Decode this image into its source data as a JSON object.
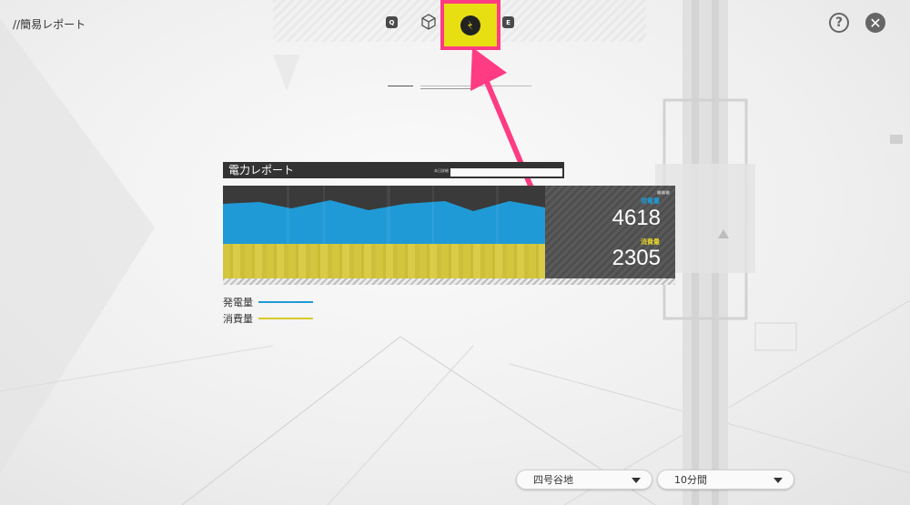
{
  "header": {
    "title": "//簡易レポート",
    "tabs": [
      {
        "label": "Q",
        "icon": "q-key-icon"
      },
      {
        "label": "",
        "icon": "cube-icon"
      },
      {
        "label": "",
        "icon": "power-icon",
        "active": true
      },
      {
        "label": "E",
        "icon": "e-key-icon"
      }
    ],
    "help_label": "?",
    "close_label": "✕"
  },
  "panel": {
    "title": "電力レポート",
    "header_tag": "本日詳細",
    "generation_label": "発電量",
    "generation_value": "4618",
    "consumption_label": "消費量",
    "consumption_value": "2305"
  },
  "legend": {
    "generation": "発電量",
    "consumption": "消費量"
  },
  "selects": {
    "area": "四号谷地",
    "interval": "10分間"
  },
  "colors": {
    "generation": "#1f9ad6",
    "consumption": "#d3c63e",
    "highlight": "#ff3b84",
    "active_tab": "#e8df13"
  }
}
